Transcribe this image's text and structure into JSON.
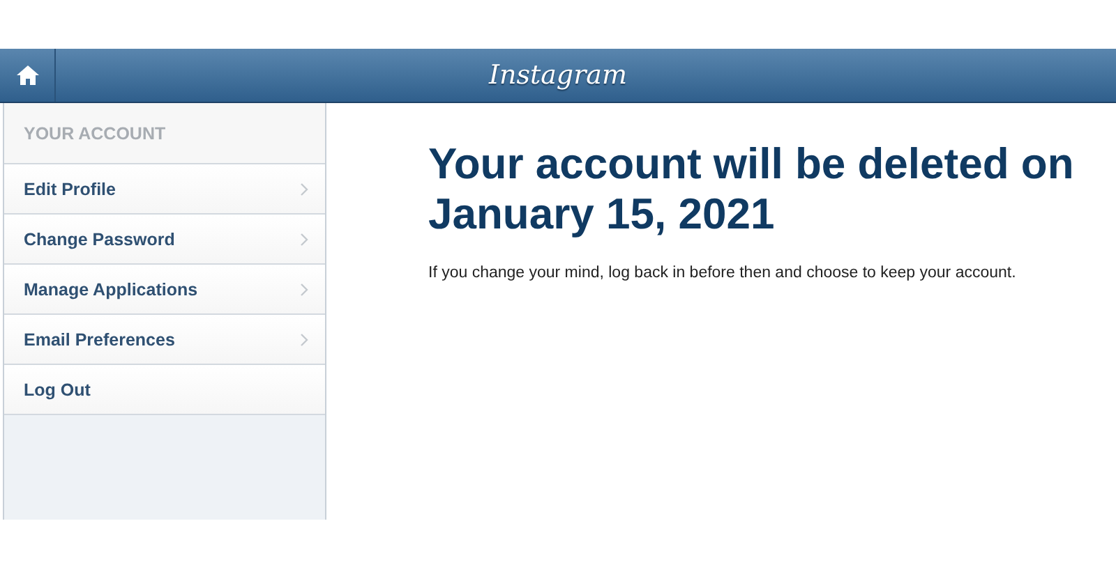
{
  "header": {
    "title": "Instagram"
  },
  "sidebar": {
    "heading": "YOUR ACCOUNT",
    "items": [
      {
        "label": "Edit Profile",
        "chevron": true
      },
      {
        "label": "Change Password",
        "chevron": true
      },
      {
        "label": "Manage Applications",
        "chevron": true
      },
      {
        "label": "Email Preferences",
        "chevron": true
      },
      {
        "label": "Log Out",
        "chevron": false
      }
    ]
  },
  "main": {
    "heading": "Your account will be deleted on January 15, 2021",
    "message": "If you change your mind, log back in before then and choose to keep your account."
  }
}
